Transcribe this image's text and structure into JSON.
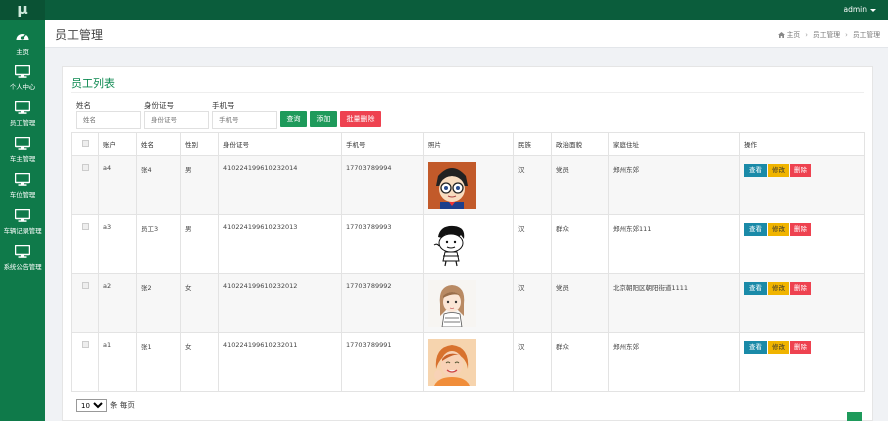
{
  "topbar": {
    "logo": "μ",
    "user": "admin"
  },
  "sidebar": {
    "items": [
      {
        "label": "主页",
        "icon": "dashboard-icon"
      },
      {
        "label": "个人中心",
        "icon": "monitor-icon"
      },
      {
        "label": "员工管理",
        "icon": "monitor-icon"
      },
      {
        "label": "车主管理",
        "icon": "monitor-icon"
      },
      {
        "label": "车位管理",
        "icon": "monitor-icon"
      },
      {
        "label": "车辆记录管理",
        "icon": "monitor-icon"
      },
      {
        "label": "系统公告管理",
        "icon": "monitor-icon"
      }
    ]
  },
  "header": {
    "title": "员工管理",
    "breadcrumb": [
      "主页",
      "员工管理",
      "员工管理"
    ]
  },
  "panel": {
    "title": "员工列表"
  },
  "filters": {
    "name_label": "姓名",
    "name_placeholder": "姓名",
    "idcard_label": "身份证号",
    "idcard_placeholder": "身份证号",
    "phone_label": "手机号",
    "phone_placeholder": "手机号",
    "search_label": "查询",
    "add_label": "添加",
    "batch_delete_label": "批量删除"
  },
  "table": {
    "headers": [
      "",
      "账户",
      "姓名",
      "性别",
      "身份证号",
      "手机号",
      "照片",
      "民族",
      "政治面貌",
      "家庭住址",
      "操作"
    ],
    "actions": {
      "view": "查看",
      "edit": "修改",
      "delete": "删除"
    },
    "rows": [
      {
        "account": "a4",
        "name": "张4",
        "gender": "男",
        "idcard": "410224199610232014",
        "phone": "17703789994",
        "photo": "cartoon-detective-avatar",
        "ethnic": "汉",
        "political": "党员",
        "address": "郑州东郊"
      },
      {
        "account": "a3",
        "name": "员工3",
        "gender": "男",
        "idcard": "410224199610232013",
        "phone": "17703789993",
        "photo": "cartoon-boy-sketch-avatar",
        "ethnic": "汉",
        "political": "群众",
        "address": "郑州东郊111"
      },
      {
        "account": "a2",
        "name": "张2",
        "gender": "女",
        "idcard": "410224199610232012",
        "phone": "17703789992",
        "photo": "cartoon-girl-sketch-avatar",
        "ethnic": "汉",
        "political": "党员",
        "address": "北京朝阳区朝阳街道1111"
      },
      {
        "account": "a1",
        "name": "张1",
        "gender": "女",
        "idcard": "410224199610232011",
        "phone": "17703789991",
        "photo": "woman-photo-avatar",
        "ethnic": "汉",
        "political": "群众",
        "address": "郑州东郊"
      }
    ]
  },
  "pagination": {
    "page_size": "10",
    "per_page_text": "条 每页"
  },
  "colors": {
    "sidebar": "#0f7a4a",
    "topbar": "#0b5d3c",
    "accent": "#1e9a5b",
    "danger": "#ee4250",
    "warning": "#f0b400",
    "info": "#1a8aa8"
  }
}
